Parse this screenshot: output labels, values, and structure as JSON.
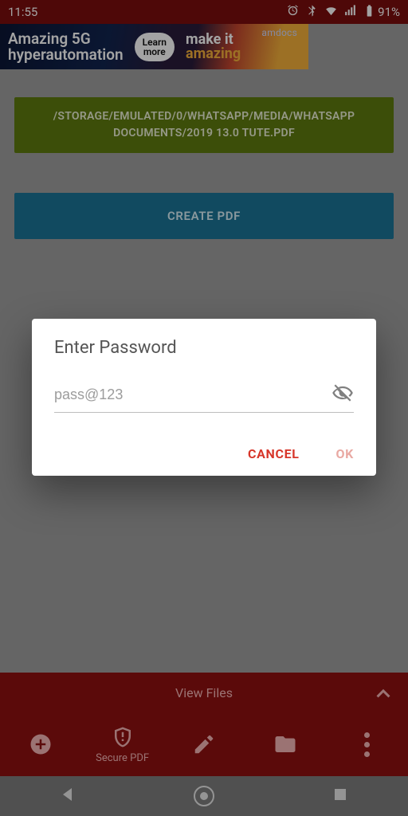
{
  "status": {
    "time": "11:55",
    "battery": "91%"
  },
  "ad": {
    "headline_l1": "Amazing 5G",
    "headline_l2": "hyperautomation",
    "pill_l1": "Learn",
    "pill_l2": "more",
    "sub": "amdocs",
    "right_l1": "make it",
    "right_l2": "amazing"
  },
  "file_path_l1": "/STORAGE/EMULATED/0/WHATSAPP/MEDIA/WHATSAPP",
  "file_path_l2": "DOCUMENTS/2019 13.0 TUTE.PDF",
  "create_label": "CREATE PDF",
  "dialog": {
    "title": "Enter Password",
    "placeholder": "pass@123",
    "value": "",
    "cancel": "CANCEL",
    "ok": "OK"
  },
  "bottom": {
    "view_files": "View Files",
    "secure_label": "Secure PDF"
  },
  "colors": {
    "darkred": "#a51c1c",
    "teal": "#1c7597",
    "olive": "#5e7a0f"
  }
}
